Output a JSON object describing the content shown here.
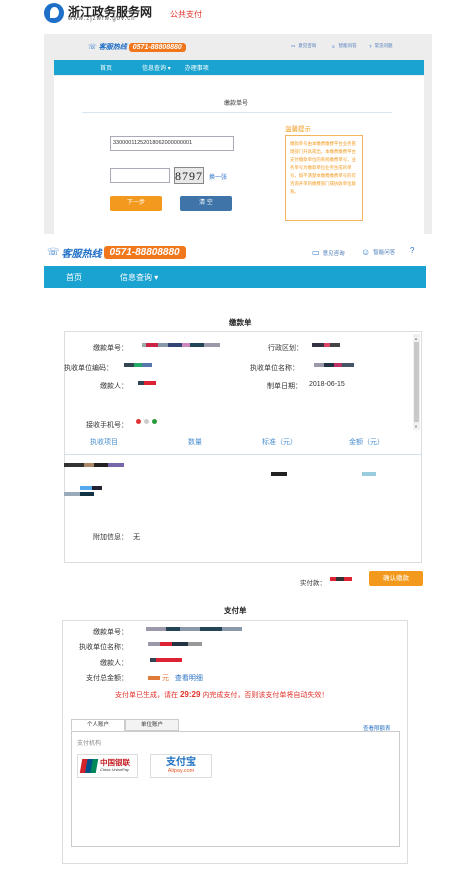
{
  "header": {
    "site_title": "浙江政务服务网",
    "site_url": "www.zjzwfw.gov.cn",
    "section_link": "公共支付"
  },
  "hotline": {
    "label": "客服热线",
    "phone": "0571-88808880"
  },
  "utilities": [
    "意见咨询",
    "智能问答",
    "常见问题"
  ],
  "nav": {
    "home": "首页",
    "info_query": "信息查询",
    "affairs": "办理事项"
  },
  "search_panel": {
    "title": "缴款单号",
    "bill_number_value": "33000011252018062000000001",
    "captcha_text": "8797",
    "refresh_label": "换一张",
    "next_button": "下一步",
    "clear_button": "清 空",
    "tip_title": "温馨提示",
    "tip_text": "缴款单号由本缴费缴费平台业务管理部门开具或出，本缴费缴费平台支付缴款单位的系统缴费单号，业务单号为缴款单位业务生成的单号，如不清楚本缴费缴费单号的可咨询开单的缴费部门或执收单位联系。"
  },
  "bill_form": {
    "title": "缴款单",
    "fields": {
      "bill_no_label": "缴款单号：",
      "region_label": "行政区划：",
      "unit_code_label": "执收单位编码：",
      "unit_name_label": "执收单位名称：",
      "payer_label": "缴款人：",
      "date_label": "制单日期：",
      "date_value": "2018-06-15",
      "phone_label": "接收手机号："
    },
    "columns": [
      "执收项目",
      "数量",
      "标准（元）",
      "金额（元）"
    ],
    "extra_info_label": "附加信息：",
    "extra_info_value": "无",
    "paid_label": "实付款：",
    "confirm_button": "确认缴款"
  },
  "payment_bill": {
    "title": "支付单",
    "fields": {
      "bill_no_label": "缴款单号：",
      "unit_name_label": "执收单位名称：",
      "payer_label": "缴款人：",
      "total_label": "支付总金额：",
      "total_unit": "元",
      "detail_link": "查看明细"
    },
    "countdown_pre": "支付单已生成，请在",
    "countdown_time": "29:29",
    "countdown_post": "内完成支付，否则该支付单将自动失效！",
    "tabs": [
      "个人账户",
      "单位账户"
    ],
    "limit_link": "查看限额表",
    "org_label": "支付机构",
    "unionpay_cn": "中国银联",
    "unionpay_en": "China UnionPay",
    "alipay_cn": "支付宝",
    "alipay_en": "Alipay.com"
  },
  "colors": {
    "nav_blue": "#1aa3d0",
    "accent_orange": "#f39a1e",
    "link_blue": "#2b73c6",
    "warning_red": "#e0302a"
  }
}
